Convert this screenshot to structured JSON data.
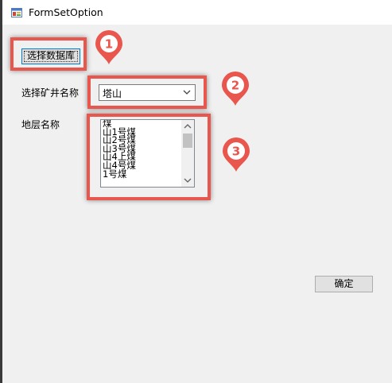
{
  "window": {
    "title": "FormSetOption"
  },
  "buttons": {
    "select_db": "选择数据库",
    "confirm": "确定"
  },
  "mine": {
    "label": "选择矿井名称",
    "selected": "塔山"
  },
  "strata": {
    "label": "地层名称",
    "items": [
      "煤",
      "山1号煤",
      "山2号煤",
      "山3号煤",
      "山4上煤",
      "山4号煤",
      "1号煤"
    ]
  },
  "markers": [
    "1",
    "2",
    "3"
  ],
  "colors": {
    "highlight": "#e8564d",
    "focus": "#0078d7"
  }
}
